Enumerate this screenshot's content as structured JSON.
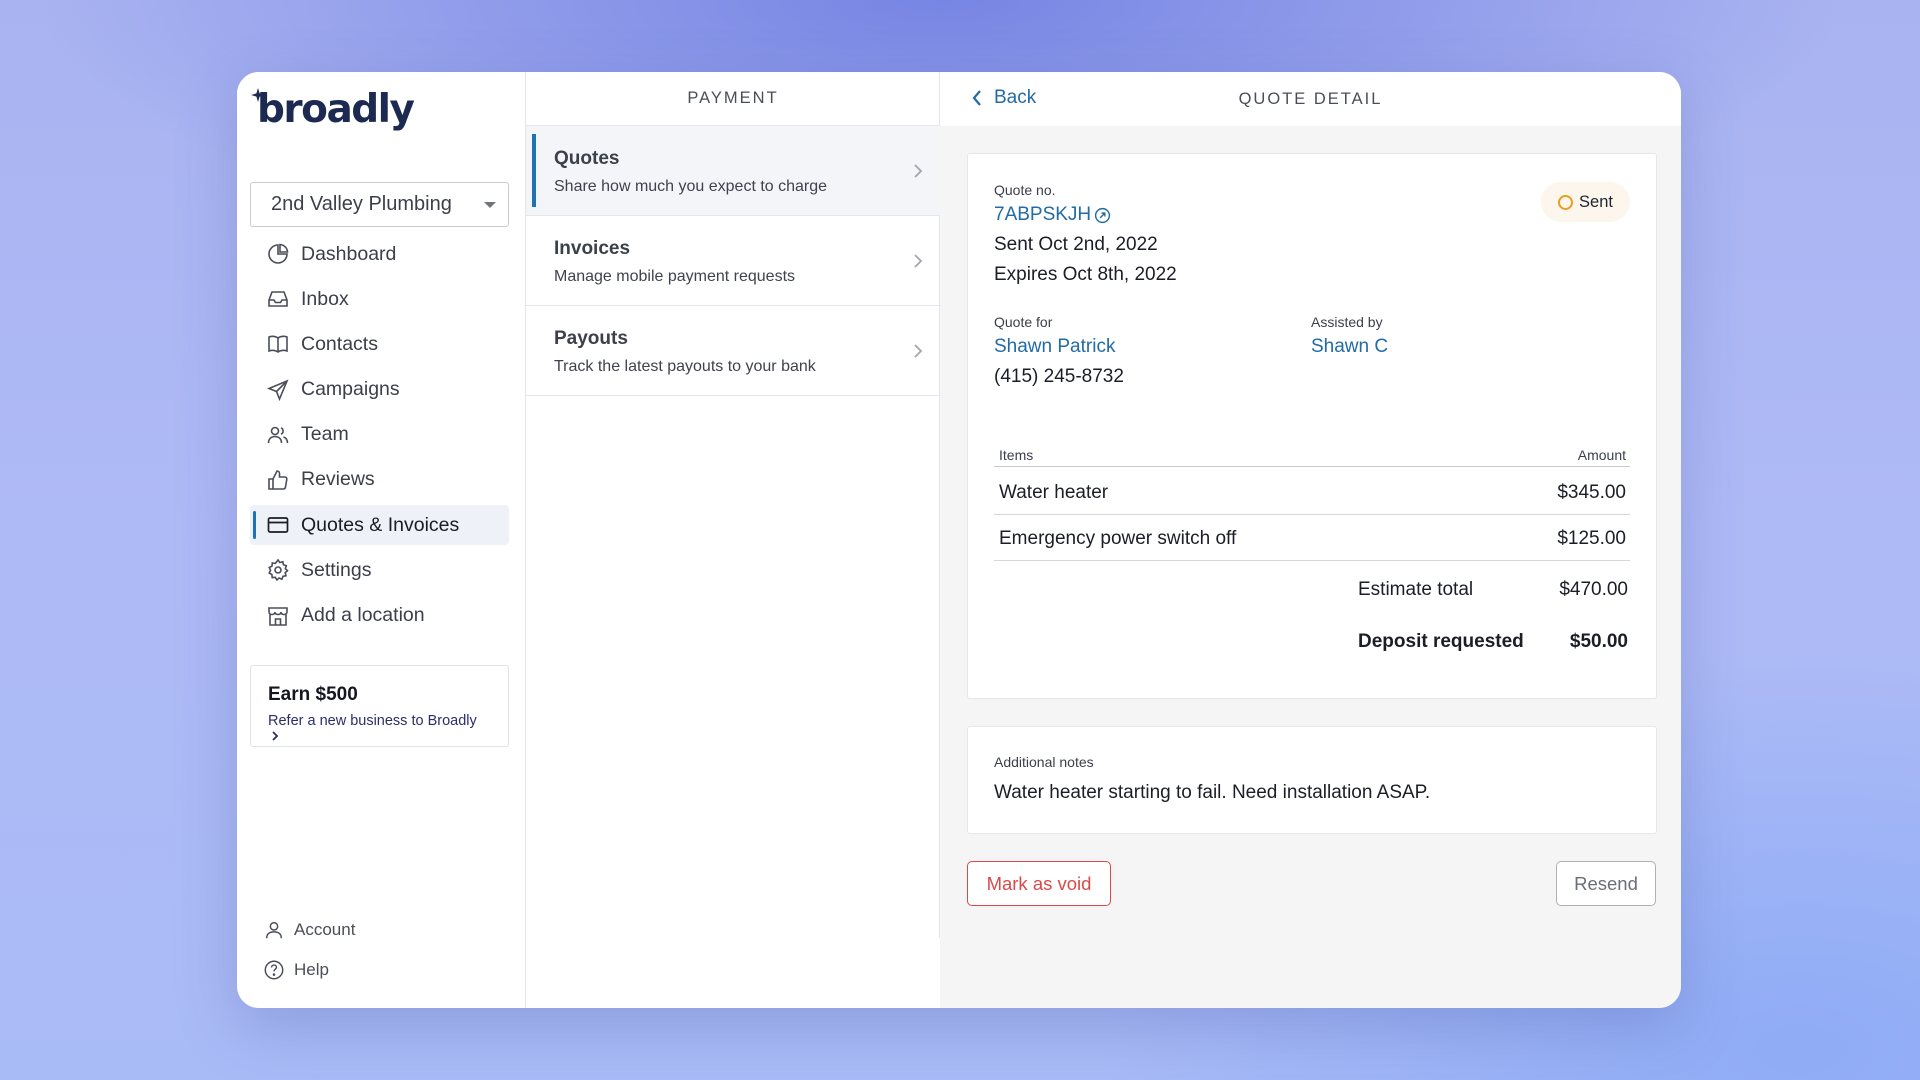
{
  "brand": {
    "logo_text": "broadly"
  },
  "sidebar": {
    "location": "2nd Valley Plumbing",
    "items": [
      {
        "label": "Dashboard",
        "icon": "pie-chart-icon"
      },
      {
        "label": "Inbox",
        "icon": "inbox-tray-icon"
      },
      {
        "label": "Contacts",
        "icon": "book-icon"
      },
      {
        "label": "Campaigns",
        "icon": "paper-plane-icon"
      },
      {
        "label": "Team",
        "icon": "users-icon"
      },
      {
        "label": "Reviews",
        "icon": "thumbs-up-icon"
      },
      {
        "label": "Quotes & Invoices",
        "icon": "credit-card-icon",
        "active": true
      },
      {
        "label": "Settings",
        "icon": "gear-icon"
      },
      {
        "label": "Add a location",
        "icon": "storefront-icon"
      }
    ],
    "earn": {
      "title": "Earn $500",
      "link": "Refer a new business to Broadly"
    },
    "bottom": {
      "account": "Account",
      "help": "Help"
    }
  },
  "payment": {
    "header": "PAYMENT",
    "items": [
      {
        "title": "Quotes",
        "subtitle": "Share how much you expect to charge",
        "active": true
      },
      {
        "title": "Invoices",
        "subtitle": "Manage mobile payment requests"
      },
      {
        "title": "Payouts",
        "subtitle": "Track the latest payouts to your bank"
      }
    ]
  },
  "detail": {
    "header": "QUOTE DETAIL",
    "back": "Back",
    "quote_no_label": "Quote no.",
    "quote_no": "7ABPSKJH",
    "sent": "Sent Oct 2nd, 2022",
    "expires": "Expires Oct 8th, 2022",
    "status": "Sent",
    "status_color": "#e8a021",
    "quote_for_label": "Quote for",
    "quote_for_name": "Shawn Patrick",
    "quote_for_phone": "(415) 245-8732",
    "assisted_by_label": "Assisted by",
    "assisted_by_name": "Shawn C",
    "items_header": "Items",
    "amount_header": "Amount",
    "items": [
      {
        "name": "Water heater",
        "amount": "$345.00"
      },
      {
        "name": "Emergency power switch off",
        "amount": "$125.00"
      }
    ],
    "estimate_total_label": "Estimate total",
    "estimate_total": "$470.00",
    "deposit_label": "Deposit requested",
    "deposit": "$50.00",
    "notes_label": "Additional notes",
    "notes": "Water heater starting to fail. Need installation ASAP.",
    "void_button": "Mark as void",
    "resend_button": "Resend"
  },
  "colors": {
    "accent": "#1d73b3",
    "link": "#236ba5",
    "danger": "#d84a4a",
    "navy": "#1c2a52"
  }
}
